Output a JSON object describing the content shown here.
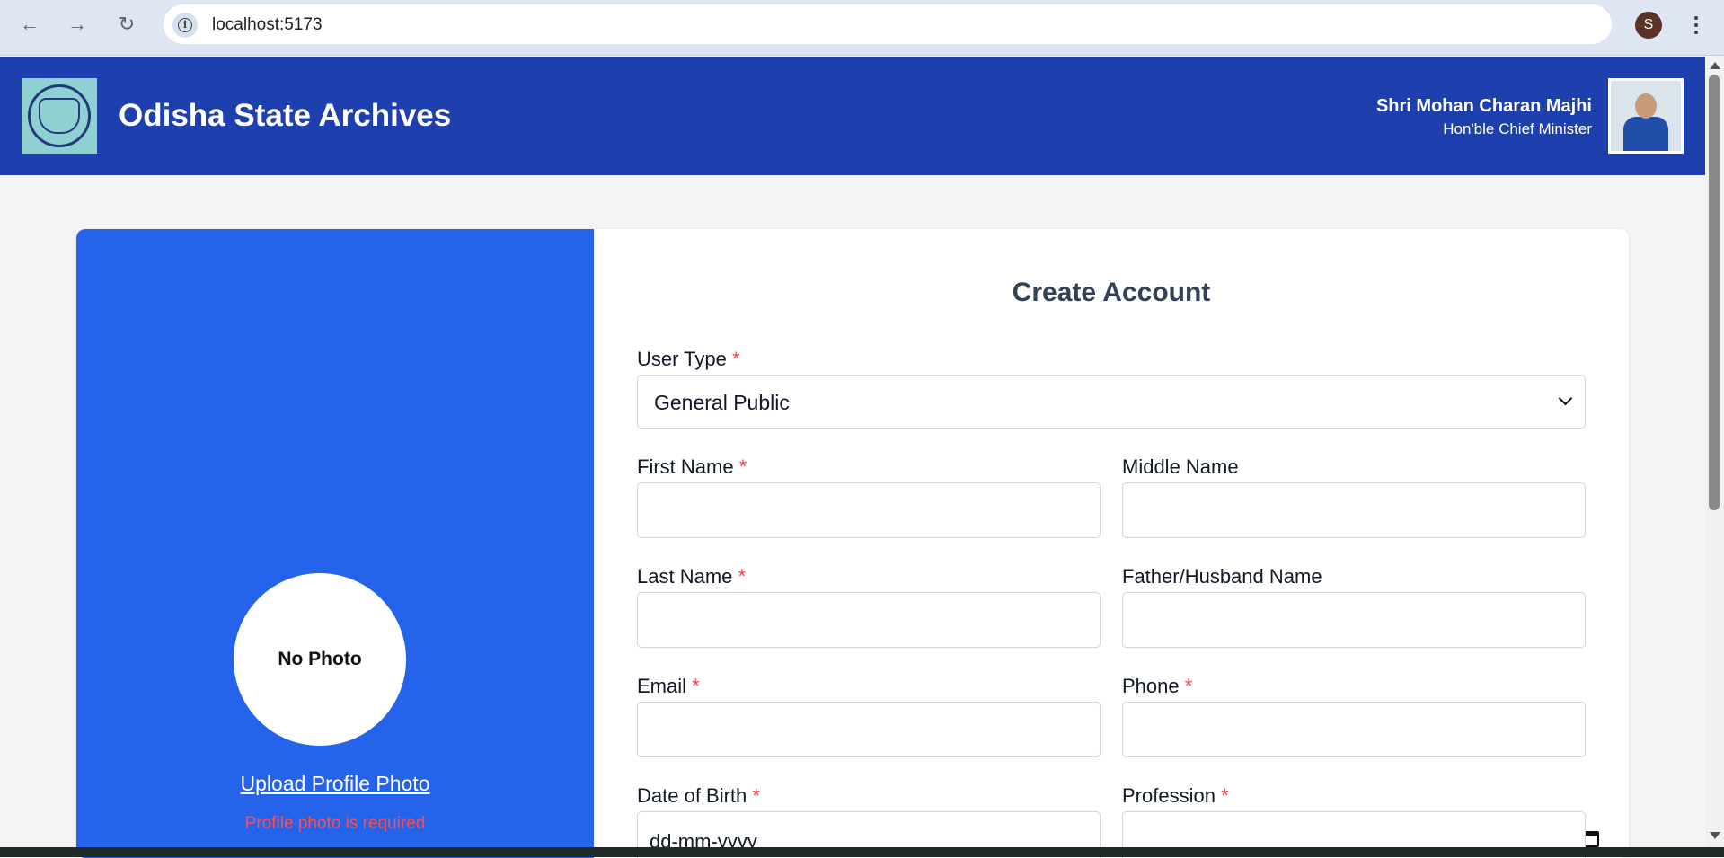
{
  "browser": {
    "url": "localhost:5173",
    "profile_initial": "S"
  },
  "header": {
    "site_title": "Odisha State Archives",
    "cm_name": "Shri Mohan Charan Majhi",
    "cm_title": "Hon'ble Chief Minister"
  },
  "left_panel": {
    "photo_placeholder": "No Photo",
    "upload_label": "Upload Profile Photo",
    "error_text": "Profile photo is required",
    "color": "#2563eb"
  },
  "form": {
    "title": "Create Account",
    "required_mark": "*",
    "user_type": {
      "label": "User Type",
      "value": "General Public"
    },
    "first_name": {
      "label": "First Name",
      "value": ""
    },
    "middle_name": {
      "label": "Middle Name",
      "value": ""
    },
    "last_name": {
      "label": "Last Name",
      "value": ""
    },
    "father_husband_name": {
      "label": "Father/Husband Name",
      "value": ""
    },
    "email": {
      "label": "Email",
      "value": ""
    },
    "phone": {
      "label": "Phone",
      "value": ""
    },
    "date_of_birth": {
      "label": "Date of Birth",
      "placeholder": "dd-mm-yyyy"
    },
    "profession": {
      "label": "Profession",
      "value": ""
    }
  },
  "colors": {
    "header_bg": "#1e40af",
    "required": "#ef4444",
    "error": "#ff4d4f"
  }
}
